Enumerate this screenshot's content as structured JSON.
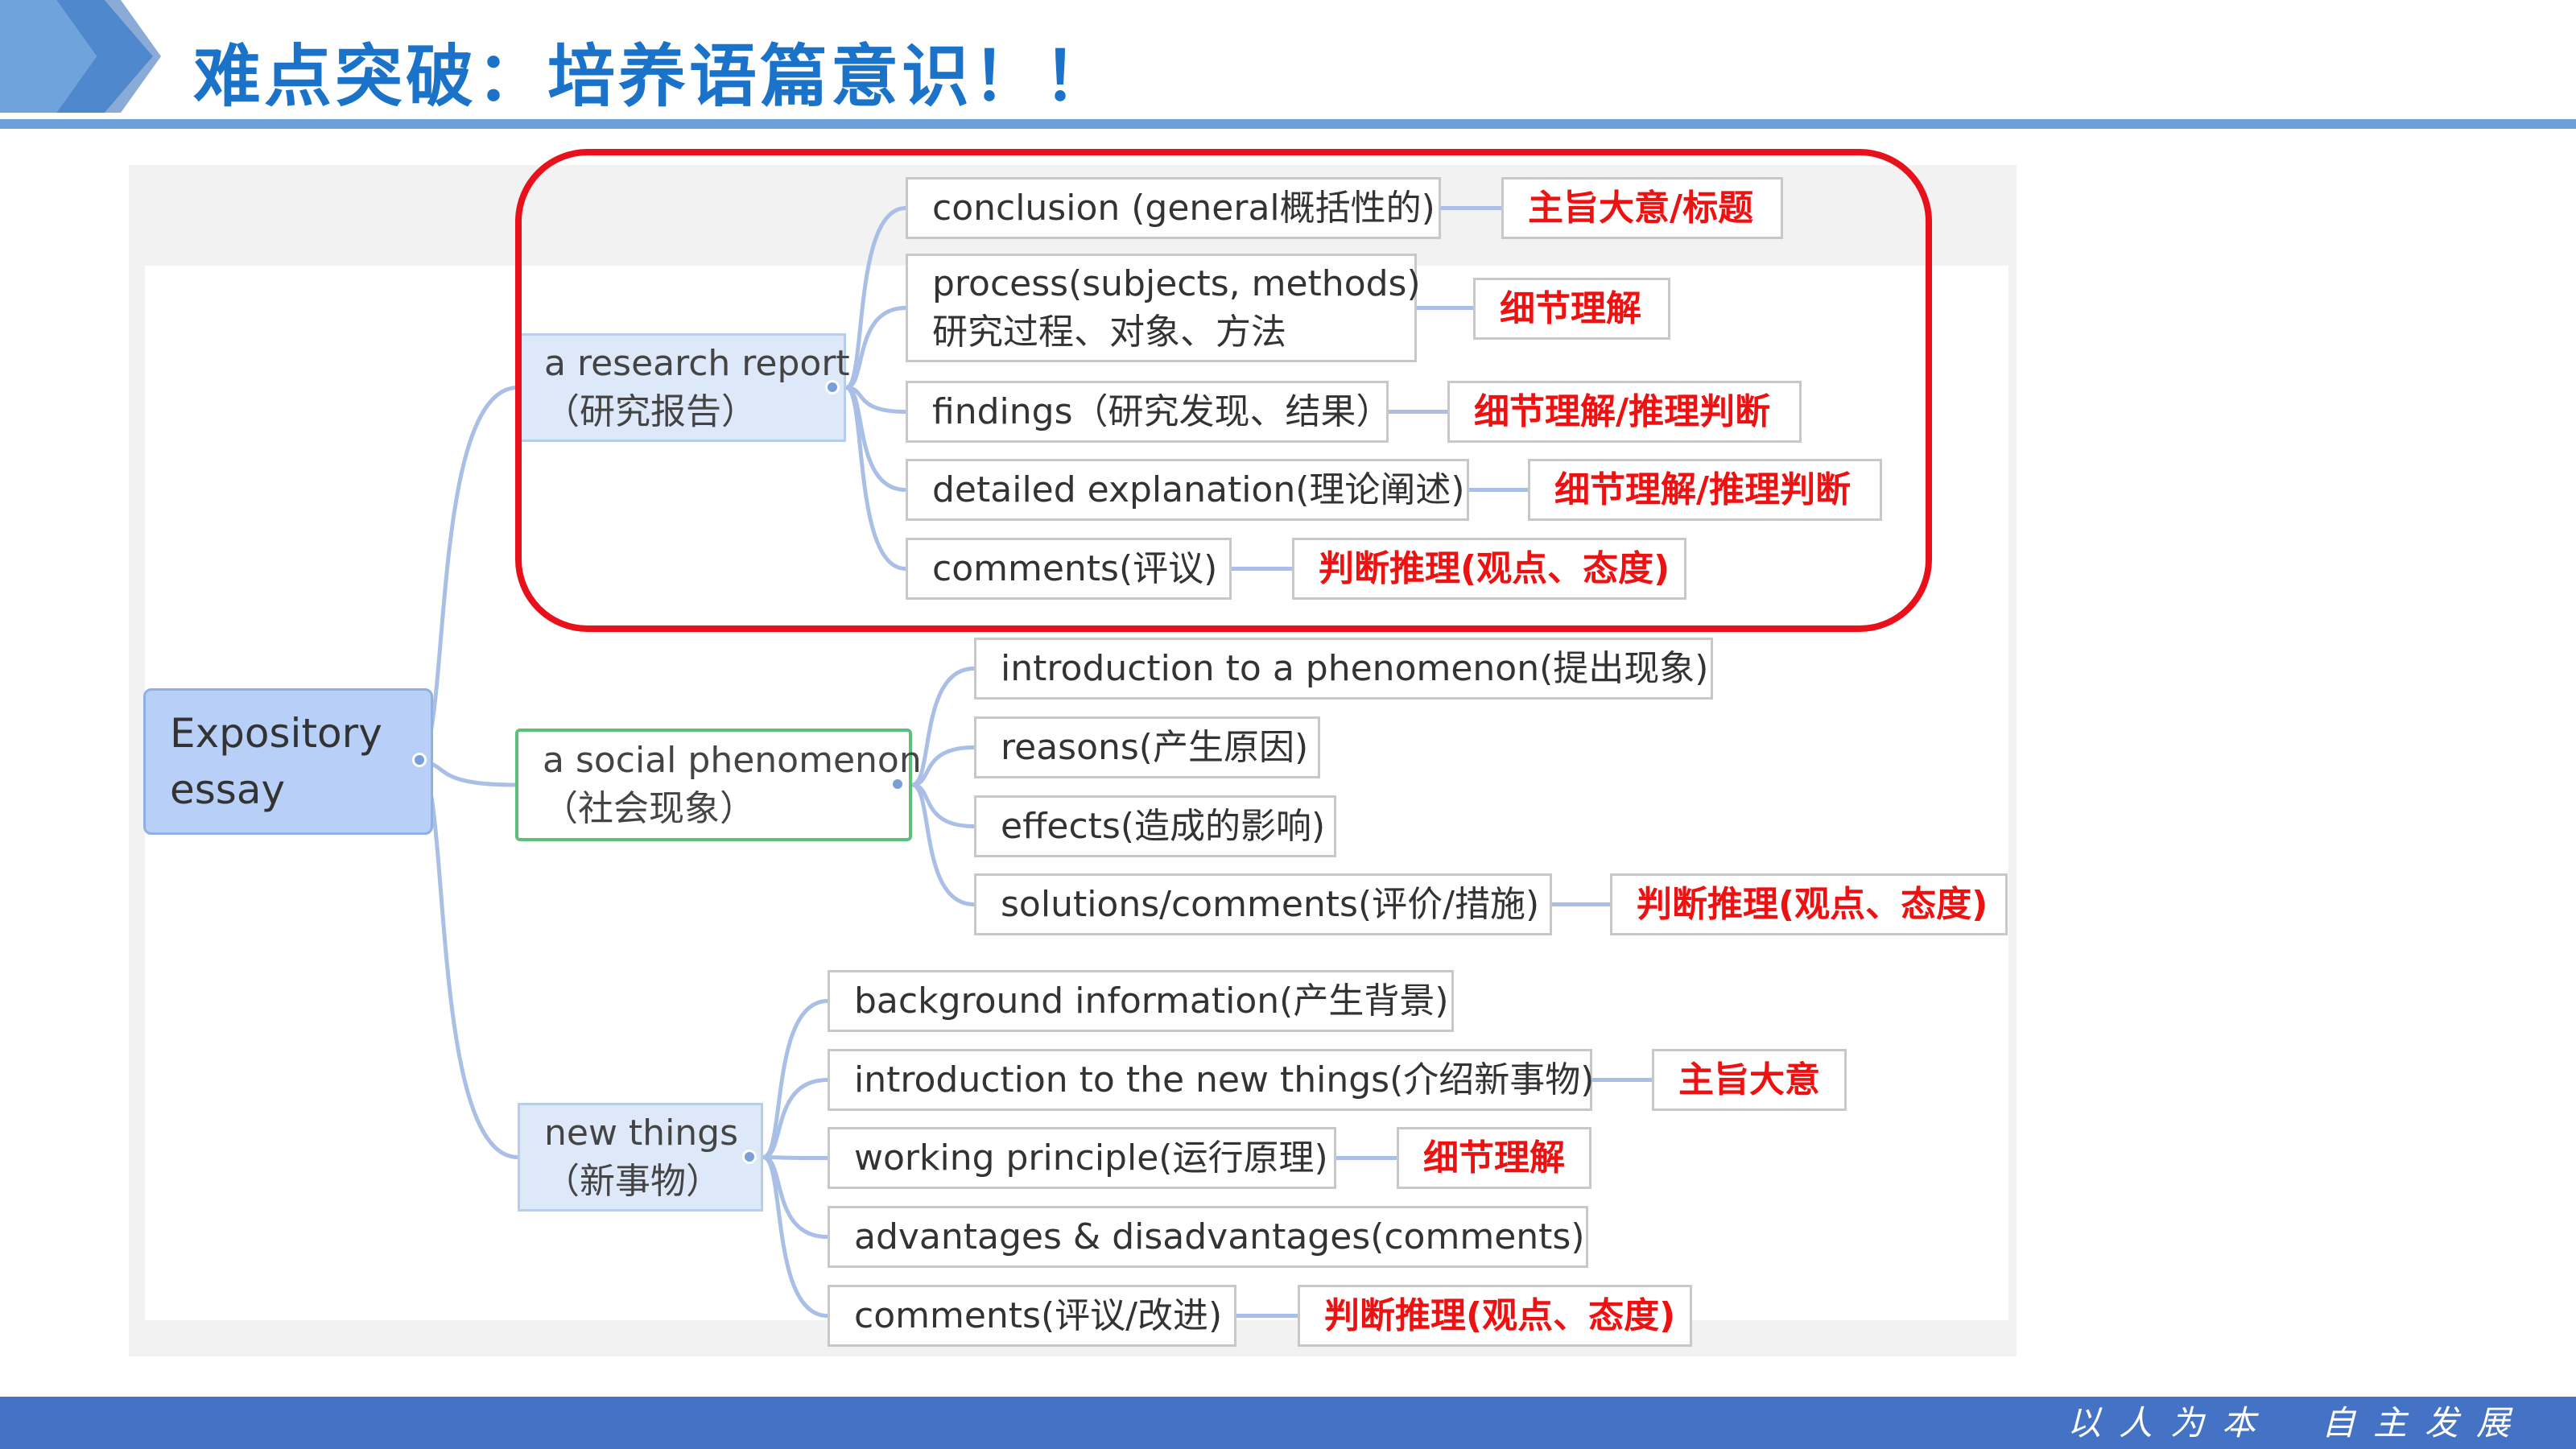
{
  "title": "难点突破：培养语篇意识！！",
  "mindmap": {
    "root": [
      "Expository",
      "essay"
    ],
    "branches": [
      {
        "text": [
          "a research report",
          "（研究报告）"
        ],
        "children": [
          {
            "text": [
              "conclusion (general概括性的)"
            ],
            "label": "主旨大意/标题"
          },
          {
            "text": [
              "process(subjects, methods)",
              "研究过程、对象、方法"
            ],
            "label": "细节理解"
          },
          {
            "text": [
              "findings（研究发现、结果）"
            ],
            "label": "细节理解/推理判断"
          },
          {
            "text": [
              "detailed explanation(理论阐述)"
            ],
            "label": "细节理解/推理判断"
          },
          {
            "text": [
              "comments(评议)"
            ],
            "label": "判断推理(观点、态度)"
          }
        ]
      },
      {
        "text": [
          "a social phenomenon",
          "（社会现象）"
        ],
        "children": [
          {
            "text": [
              "introduction to a phenomenon(提出现象)"
            ],
            "label": ""
          },
          {
            "text": [
              "reasons(产生原因)"
            ],
            "label": ""
          },
          {
            "text": [
              "effects(造成的影响)"
            ],
            "label": ""
          },
          {
            "text": [
              "solutions/comments(评价/措施)"
            ],
            "label": "判断推理(观点、态度)"
          }
        ]
      },
      {
        "text": [
          "new things",
          "（新事物）"
        ],
        "children": [
          {
            "text": [
              "background information(产生背景)"
            ],
            "label": ""
          },
          {
            "text": [
              "introduction to the new things(介绍新事物)"
            ],
            "label": "主旨大意"
          },
          {
            "text": [
              "working principle(运行原理)"
            ],
            "label": "细节理解"
          },
          {
            "text": [
              "advantages & disadvantages(comments)"
            ],
            "label": ""
          },
          {
            "text": [
              "comments(评议/改进)"
            ],
            "label": "判断推理(观点、态度)"
          }
        ]
      }
    ]
  },
  "footer": {
    "motto_left": "以人为本",
    "motto_right": "自主发展"
  },
  "colors": {
    "title": "#1a73c8",
    "label": "#ee1111",
    "highlight": "#e8101a",
    "footer": "#4472c4",
    "connector": "#a9bfe6"
  }
}
